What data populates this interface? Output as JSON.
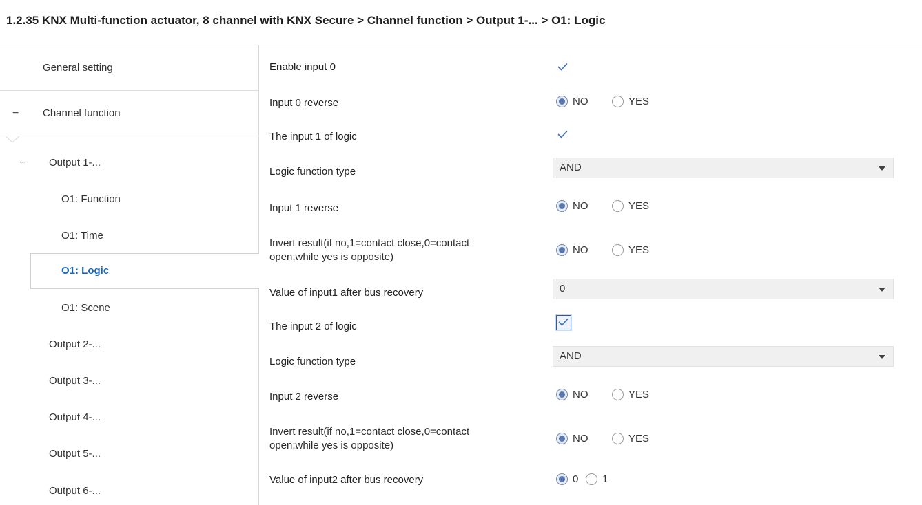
{
  "breadcrumb": "1.2.35 KNX Multi-function actuator, 8 channel with KNX Secure > Channel function > Output 1-... > O1: Logic",
  "sidebar": {
    "items": [
      {
        "label": "General setting"
      },
      {
        "label": "Channel function",
        "toggle": "−"
      },
      {
        "label": "Output 1-...",
        "toggle": "−"
      },
      {
        "label": "O1: Function"
      },
      {
        "label": "O1: Time"
      },
      {
        "label": "O1: Logic",
        "selected": true
      },
      {
        "label": "O1: Scene"
      },
      {
        "label": "Output 2-..."
      },
      {
        "label": "Output 3-..."
      },
      {
        "label": "Output 4-..."
      },
      {
        "label": "Output 5-..."
      },
      {
        "label": "Output 6-..."
      }
    ]
  },
  "params": [
    {
      "label": "Enable input 0",
      "type": "checkbox",
      "checked": true
    },
    {
      "label": "Input 0 reverse",
      "type": "radio",
      "options": [
        "NO",
        "YES"
      ],
      "selected": "NO"
    },
    {
      "label": "The input 1 of logic",
      "type": "checkbox",
      "checked": true
    },
    {
      "label": "Logic function type",
      "type": "select",
      "value": "AND"
    },
    {
      "label": "Input 1 reverse",
      "type": "radio",
      "options": [
        "NO",
        "YES"
      ],
      "selected": "NO"
    },
    {
      "label": "Invert result(if no,1=contact close,0=contact open;while yes is opposite)",
      "label_line1": "Invert result(if no,1=contact close,0=contact",
      "label_line2": "open;while yes is opposite)",
      "type": "radio",
      "options": [
        "NO",
        "YES"
      ],
      "selected": "NO"
    },
    {
      "label": "Value of input1 after bus recovery",
      "type": "select",
      "value": "0"
    },
    {
      "label": "The input 2 of logic",
      "type": "checkbox",
      "checked": true,
      "focused": true
    },
    {
      "label": "Logic function type",
      "type": "select",
      "value": "AND"
    },
    {
      "label": "Input 2 reverse",
      "type": "radio",
      "options": [
        "NO",
        "YES"
      ],
      "selected": "NO"
    },
    {
      "label": "Invert result(if no,1=contact close,0=contact open;while yes is opposite)",
      "label_line1": "Invert result(if no,1=contact close,0=contact",
      "label_line2": "open;while yes is opposite)",
      "type": "radio",
      "options": [
        "NO",
        "YES"
      ],
      "selected": "NO"
    },
    {
      "label": "Value of input2 after bus recovery",
      "type": "radio",
      "options": [
        "0",
        "1"
      ],
      "selected": "0"
    }
  ],
  "colors": {
    "selected_nav_text": "#1a66b3",
    "radio_dot": "#5877b0",
    "check": "#3b6ec2",
    "select_bg": "#f0f0f0"
  },
  "icons": {
    "check": "checkmark-icon",
    "dropdown": "chevron-down-icon",
    "collapse": "minus-icon"
  }
}
